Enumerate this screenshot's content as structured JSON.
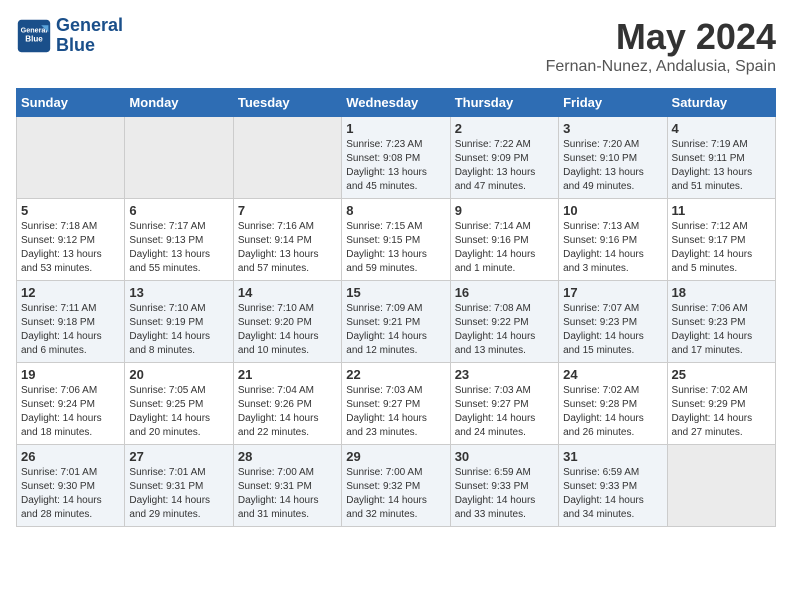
{
  "header": {
    "logo_line1": "General",
    "logo_line2": "Blue",
    "month_year": "May 2024",
    "location": "Fernan-Nunez, Andalusia, Spain"
  },
  "weekdays": [
    "Sunday",
    "Monday",
    "Tuesday",
    "Wednesday",
    "Thursday",
    "Friday",
    "Saturday"
  ],
  "weeks": [
    [
      {
        "day": "",
        "info": ""
      },
      {
        "day": "",
        "info": ""
      },
      {
        "day": "",
        "info": ""
      },
      {
        "day": "1",
        "info": "Sunrise: 7:23 AM\nSunset: 9:08 PM\nDaylight: 13 hours\nand 45 minutes."
      },
      {
        "day": "2",
        "info": "Sunrise: 7:22 AM\nSunset: 9:09 PM\nDaylight: 13 hours\nand 47 minutes."
      },
      {
        "day": "3",
        "info": "Sunrise: 7:20 AM\nSunset: 9:10 PM\nDaylight: 13 hours\nand 49 minutes."
      },
      {
        "day": "4",
        "info": "Sunrise: 7:19 AM\nSunset: 9:11 PM\nDaylight: 13 hours\nand 51 minutes."
      }
    ],
    [
      {
        "day": "5",
        "info": "Sunrise: 7:18 AM\nSunset: 9:12 PM\nDaylight: 13 hours\nand 53 minutes."
      },
      {
        "day": "6",
        "info": "Sunrise: 7:17 AM\nSunset: 9:13 PM\nDaylight: 13 hours\nand 55 minutes."
      },
      {
        "day": "7",
        "info": "Sunrise: 7:16 AM\nSunset: 9:14 PM\nDaylight: 13 hours\nand 57 minutes."
      },
      {
        "day": "8",
        "info": "Sunrise: 7:15 AM\nSunset: 9:15 PM\nDaylight: 13 hours\nand 59 minutes."
      },
      {
        "day": "9",
        "info": "Sunrise: 7:14 AM\nSunset: 9:16 PM\nDaylight: 14 hours\nand 1 minute."
      },
      {
        "day": "10",
        "info": "Sunrise: 7:13 AM\nSunset: 9:16 PM\nDaylight: 14 hours\nand 3 minutes."
      },
      {
        "day": "11",
        "info": "Sunrise: 7:12 AM\nSunset: 9:17 PM\nDaylight: 14 hours\nand 5 minutes."
      }
    ],
    [
      {
        "day": "12",
        "info": "Sunrise: 7:11 AM\nSunset: 9:18 PM\nDaylight: 14 hours\nand 6 minutes."
      },
      {
        "day": "13",
        "info": "Sunrise: 7:10 AM\nSunset: 9:19 PM\nDaylight: 14 hours\nand 8 minutes."
      },
      {
        "day": "14",
        "info": "Sunrise: 7:10 AM\nSunset: 9:20 PM\nDaylight: 14 hours\nand 10 minutes."
      },
      {
        "day": "15",
        "info": "Sunrise: 7:09 AM\nSunset: 9:21 PM\nDaylight: 14 hours\nand 12 minutes."
      },
      {
        "day": "16",
        "info": "Sunrise: 7:08 AM\nSunset: 9:22 PM\nDaylight: 14 hours\nand 13 minutes."
      },
      {
        "day": "17",
        "info": "Sunrise: 7:07 AM\nSunset: 9:23 PM\nDaylight: 14 hours\nand 15 minutes."
      },
      {
        "day": "18",
        "info": "Sunrise: 7:06 AM\nSunset: 9:23 PM\nDaylight: 14 hours\nand 17 minutes."
      }
    ],
    [
      {
        "day": "19",
        "info": "Sunrise: 7:06 AM\nSunset: 9:24 PM\nDaylight: 14 hours\nand 18 minutes."
      },
      {
        "day": "20",
        "info": "Sunrise: 7:05 AM\nSunset: 9:25 PM\nDaylight: 14 hours\nand 20 minutes."
      },
      {
        "day": "21",
        "info": "Sunrise: 7:04 AM\nSunset: 9:26 PM\nDaylight: 14 hours\nand 22 minutes."
      },
      {
        "day": "22",
        "info": "Sunrise: 7:03 AM\nSunset: 9:27 PM\nDaylight: 14 hours\nand 23 minutes."
      },
      {
        "day": "23",
        "info": "Sunrise: 7:03 AM\nSunset: 9:27 PM\nDaylight: 14 hours\nand 24 minutes."
      },
      {
        "day": "24",
        "info": "Sunrise: 7:02 AM\nSunset: 9:28 PM\nDaylight: 14 hours\nand 26 minutes."
      },
      {
        "day": "25",
        "info": "Sunrise: 7:02 AM\nSunset: 9:29 PM\nDaylight: 14 hours\nand 27 minutes."
      }
    ],
    [
      {
        "day": "26",
        "info": "Sunrise: 7:01 AM\nSunset: 9:30 PM\nDaylight: 14 hours\nand 28 minutes."
      },
      {
        "day": "27",
        "info": "Sunrise: 7:01 AM\nSunset: 9:31 PM\nDaylight: 14 hours\nand 29 minutes."
      },
      {
        "day": "28",
        "info": "Sunrise: 7:00 AM\nSunset: 9:31 PM\nDaylight: 14 hours\nand 31 minutes."
      },
      {
        "day": "29",
        "info": "Sunrise: 7:00 AM\nSunset: 9:32 PM\nDaylight: 14 hours\nand 32 minutes."
      },
      {
        "day": "30",
        "info": "Sunrise: 6:59 AM\nSunset: 9:33 PM\nDaylight: 14 hours\nand 33 minutes."
      },
      {
        "day": "31",
        "info": "Sunrise: 6:59 AM\nSunset: 9:33 PM\nDaylight: 14 hours\nand 34 minutes."
      },
      {
        "day": "",
        "info": ""
      }
    ]
  ]
}
